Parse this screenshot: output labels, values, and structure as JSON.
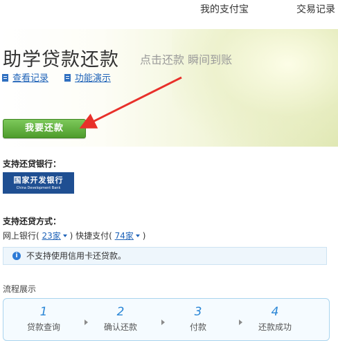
{
  "nav": {
    "my_alipay": "我的支付宝",
    "trade_records": "交易记录"
  },
  "hero": {
    "title": "助学贷款还款",
    "subtitle": "点击还款 瞬间到账"
  },
  "links": {
    "history": "查看记录",
    "demo": "功能演示"
  },
  "repay_button": "我要还款",
  "bank_section": {
    "label": "支持还贷银行：",
    "bank_logo_cn": "国家开发银行",
    "bank_logo_en": "China Development Bank"
  },
  "method_section": {
    "label": "支持还贷方式：",
    "online_bank_prefix": "网上银行(",
    "online_bank_count": "23家",
    "quick_pay_prefix": ") 快捷支付(",
    "quick_pay_count": "74家",
    "suffix": ")"
  },
  "notice": {
    "icon": "info-icon",
    "text": "不支持使用信用卡还贷款。"
  },
  "flow": {
    "title": "流程展示",
    "steps": [
      {
        "num": "1",
        "name": "贷款查询"
      },
      {
        "num": "2",
        "name": "确认还款"
      },
      {
        "num": "3",
        "name": "付款"
      },
      {
        "num": "4",
        "name": "还款成功"
      }
    ]
  },
  "colors": {
    "button_green": "#5aa934",
    "link_blue": "#1f63b8",
    "arrow_red": "#e8302a",
    "bank_blue": "#1f4f92"
  }
}
